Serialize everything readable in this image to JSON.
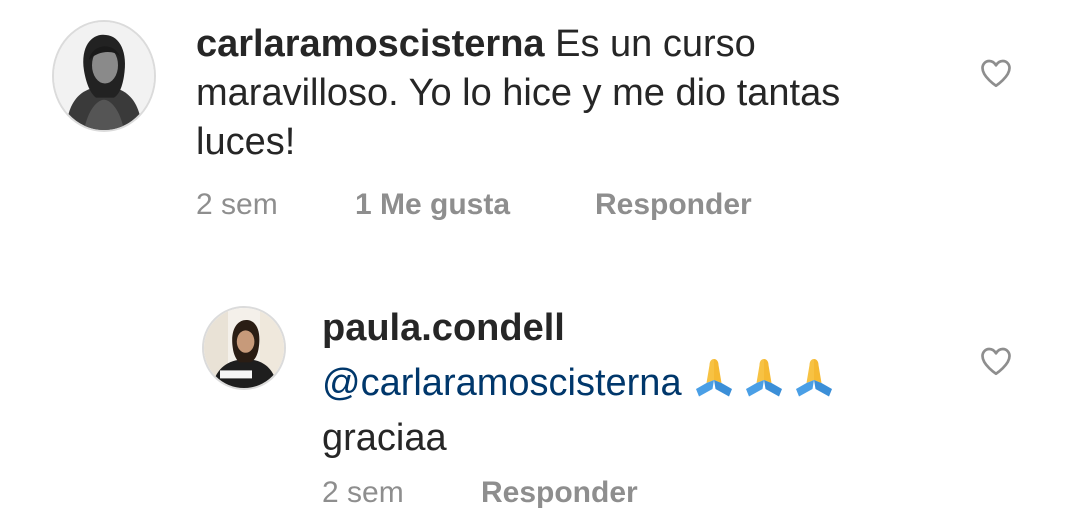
{
  "comments": [
    {
      "username": "carlaramoscisterna",
      "text": "Es un curso maravilloso. Yo lo hice y me dio tantas luces!",
      "time": "2 sem",
      "likes": "1 Me gusta",
      "reply_label": "Responder",
      "liked": false
    },
    {
      "username": "paula.condell",
      "mention": "@carlaramoscisterna",
      "emojis": [
        "folded-hands",
        "folded-hands",
        "folded-hands"
      ],
      "text": "graciaa",
      "time": "2 sem",
      "reply_label": "Responder",
      "liked": false
    }
  ],
  "icons": {
    "heart": "heart-outline-icon",
    "emoji": "folded-hands-emoji"
  },
  "colors": {
    "text": "#262626",
    "secondary": "#8e8e8e",
    "mention": "#00376b",
    "avatar_ring": "#dbdbdb",
    "emoji_skin": "#f7c243",
    "emoji_sleeve": "#4a9fe6"
  }
}
